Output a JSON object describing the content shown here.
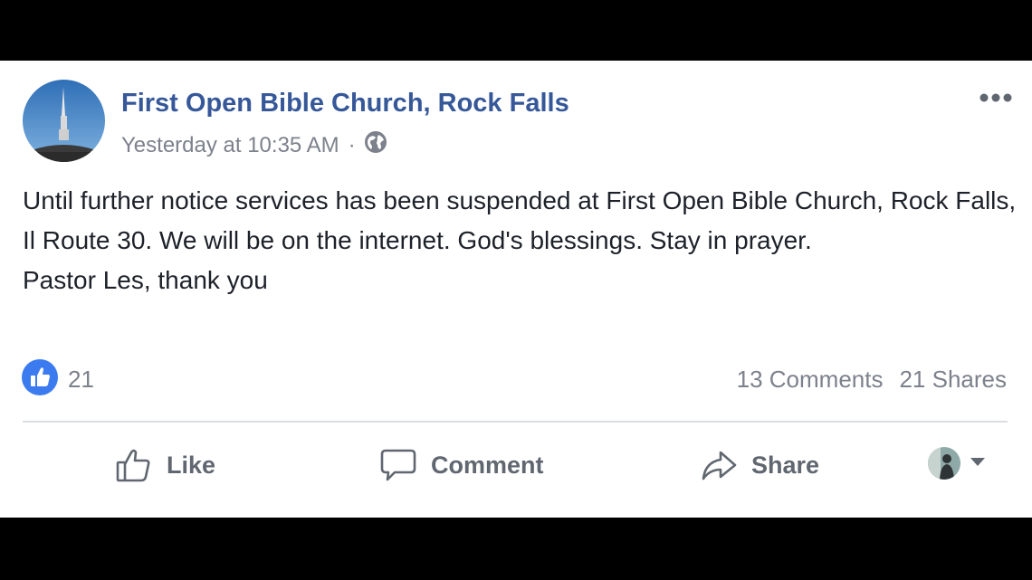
{
  "post": {
    "page_name": "First Open Bible Church, Rock Falls",
    "timestamp": "Yesterday at 10:35 AM",
    "separator": "·",
    "privacy_icon": "globe-icon",
    "body_lines": [
      "Until further notice services has been suspended at First Open Bible Church, Rock Falls, Il Route 30. We will be on the internet. God's blessings. Stay in prayer.",
      "Pastor Les, thank you"
    ]
  },
  "reactions": {
    "icon": "like-reaction-icon",
    "count": "21",
    "comments": "13 Comments",
    "shares": "21 Shares"
  },
  "actions": {
    "like": "Like",
    "comment": "Comment",
    "share": "Share"
  },
  "colors": {
    "link": "#365899",
    "meta": "#7c818c",
    "text": "#1d2129",
    "like_blue": "#3b7bef",
    "action_gray": "#606770"
  }
}
